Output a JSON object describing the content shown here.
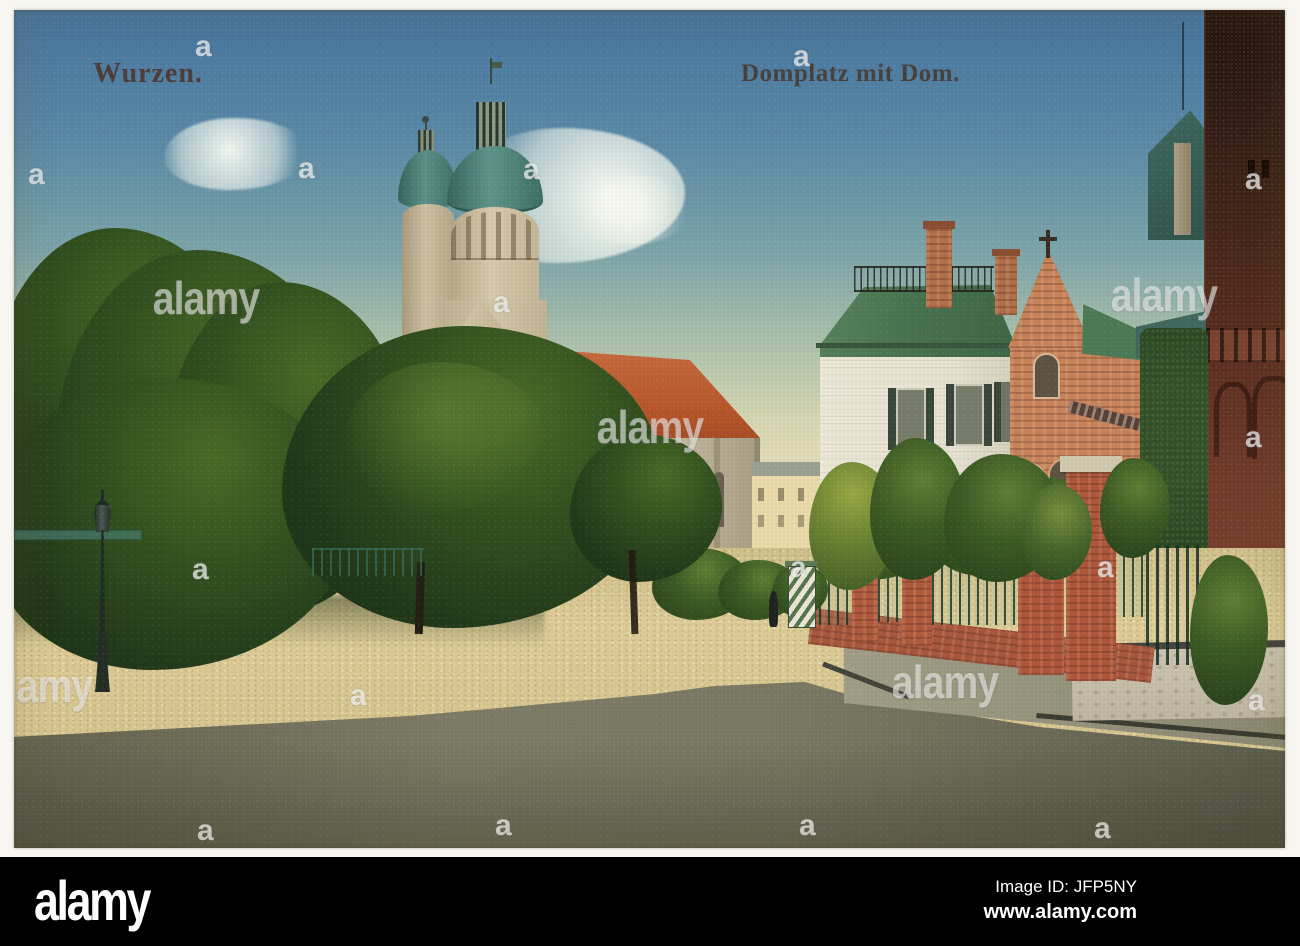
{
  "postcard": {
    "caption_left": "Wurzen.",
    "caption_right": "Domplatz mit Dom.",
    "scene": {
      "type": "hand-colored vintage postcard photograph",
      "description": "Domplatz square in Wurzen with the twin round towers of the cathedral (Dom), dark park trees, a white villa with green roof, brick gabled house, ivy-covered dark brick building, brick garden wall with iron fence, striped sentry box, street lamp and wide gravel square in front",
      "landmarks": [
        "cathedral-rear-tower",
        "cathedral-front-tower",
        "cathedral-nave",
        "white-villa",
        "brick-gable-house",
        "ivy-column",
        "dark-brick-building",
        "garden-wall",
        "sentry-box",
        "street-lamp",
        "pedestrian"
      ]
    },
    "colors": {
      "sky_top": "#46749e",
      "sky_horizon": "#f1e5c4",
      "tree_dark": "#22391a",
      "cupola_teal": "#4e7d74",
      "tower_stone": "#cfc2a4",
      "nave_roof_red": "#b95a31",
      "villa_wall": "#e9e4d4",
      "villa_roof_green": "#4f7c54",
      "brick_orange": "#c8835a",
      "dark_brick": "#542c1f",
      "garden_wall_brick": "#a8563c",
      "gravel_tan": "#d9c892",
      "street_olive": "#6b6b58",
      "border_white": "#f7f6f0"
    }
  },
  "watermark": {
    "small_glyph": "a",
    "brand": "alamy"
  },
  "footer": {
    "logo": "alamy",
    "image_id": "Image ID: JFP5NY",
    "url": "www.alamy.com",
    "background": "#000000"
  }
}
